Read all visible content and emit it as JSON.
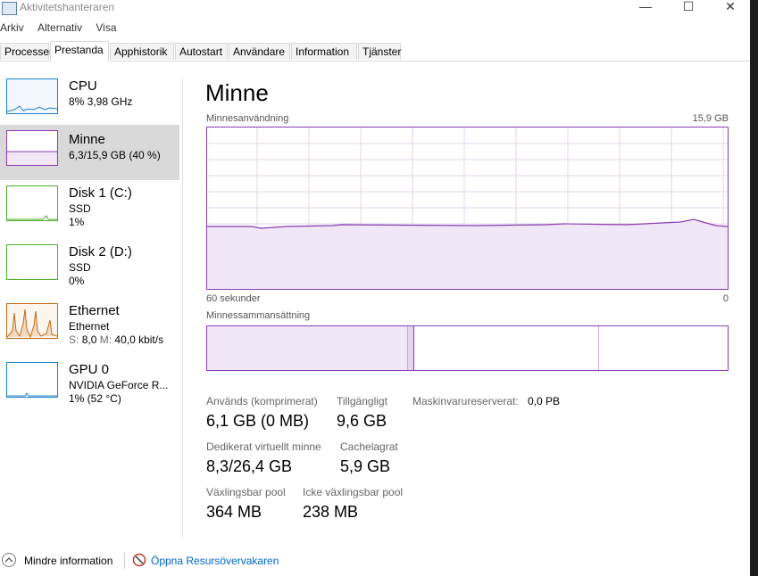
{
  "window": {
    "title": "Aktivitetshanteraren",
    "minimize": "—",
    "maximize": "☐",
    "close": "✕"
  },
  "menu": [
    "Arkiv",
    "Alternativ",
    "Visa"
  ],
  "tabs": [
    "Processer",
    "Prestanda",
    "Apphistorik",
    "Autostart",
    "Användare",
    "Information",
    "Tjänster"
  ],
  "active_tab": "Prestanda",
  "sidebar": [
    {
      "title": "CPU",
      "sub1": "8% 3,98 GHz",
      "sub2": "",
      "color": "#1e7fc8"
    },
    {
      "title": "Minne",
      "sub1": "6,3/15,9 GB (40 %)",
      "sub2": "",
      "color": "#8a3bb0"
    },
    {
      "title": "Disk 1 (C:)",
      "sub1": "SSD",
      "sub2": "1%",
      "color": "#4caf2a"
    },
    {
      "title": "Disk 2 (D:)",
      "sub1": "SSD",
      "sub2": "0%",
      "color": "#4caf2a"
    },
    {
      "title": "Ethernet",
      "sub1": "Ethernet",
      "sub2_prefix_s": "S:",
      "sub2_s": "8,0",
      "sub2_prefix_m": "M:",
      "sub2_m": "40,0 kbit/s",
      "color": "#c06a16"
    },
    {
      "title": "GPU 0",
      "sub1": "NVIDIA GeForce R...",
      "sub2": "1% (52 °C)",
      "color": "#1e7fc8"
    }
  ],
  "main": {
    "title": "Minne",
    "graph_label": "Minnesanvändning",
    "graph_max": "15,9 GB",
    "graph_time_left": "60 sekunder",
    "graph_time_right": "0",
    "composition_label": "Minnessammansättning",
    "usage_level": 0.4
  },
  "stats": {
    "used_label": "Används (komprimerat)",
    "used_value": "6,1 GB (0 MB)",
    "available_label": "Tillgängligt",
    "available_value": "9,6 GB",
    "hw_reserved_label": "Maskinvarureserverat:",
    "hw_reserved_value": "0,0 PB",
    "committed_label": "Dedikerat virtuellt minne",
    "committed_value": "8,3/26,4 GB",
    "cached_label": "Cachelagrat",
    "cached_value": "5,9 GB",
    "paged_label": "Växlingsbar pool",
    "paged_value": "364 MB",
    "nonpaged_label": "Icke växlingsbar pool",
    "nonpaged_value": "238 MB"
  },
  "footer": {
    "less_info": "Mindre information",
    "open_monitor": "Öppna Resursövervakaren"
  },
  "colors": {
    "memory_purple": "#8a3bb0",
    "link_blue": "#0066cc"
  }
}
